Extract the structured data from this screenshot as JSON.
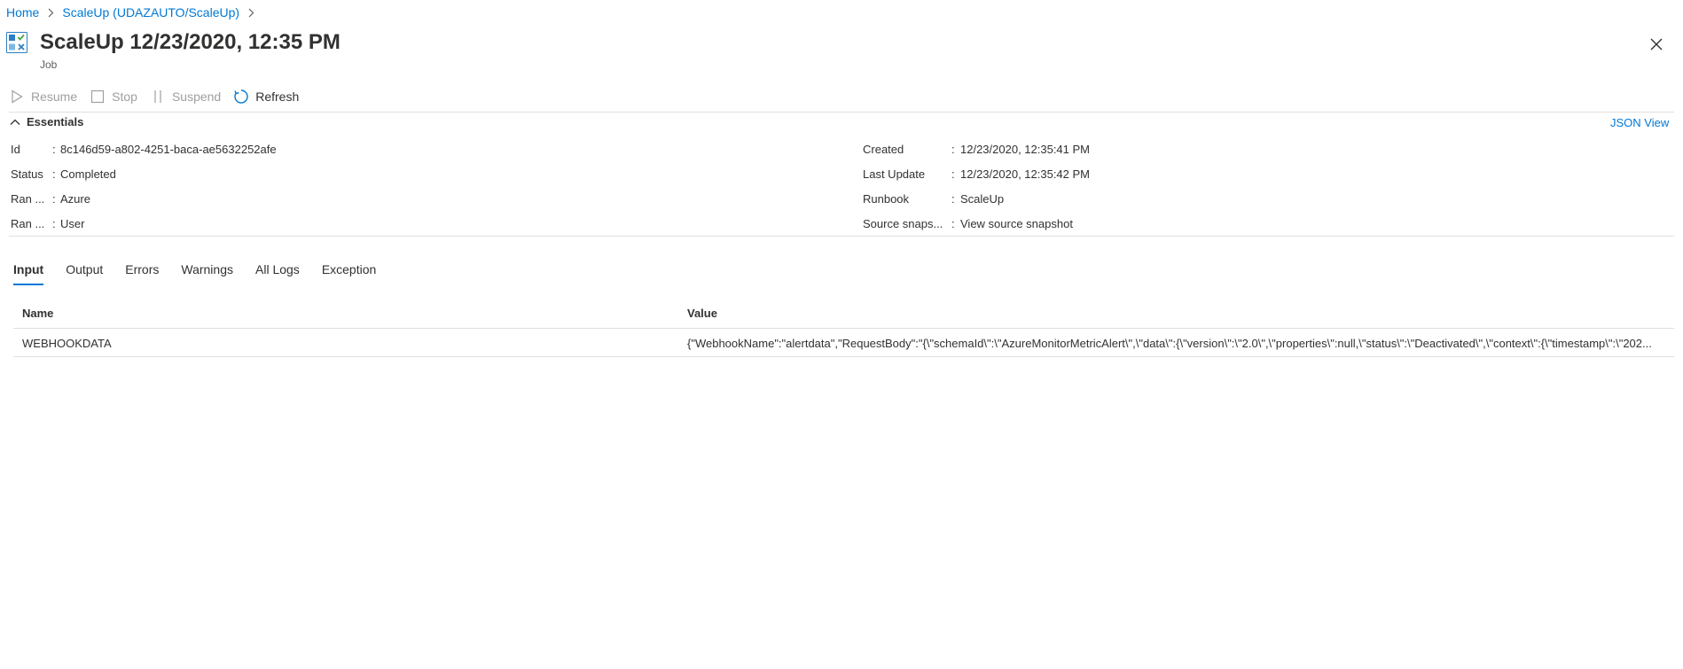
{
  "breadcrumb": {
    "items": [
      "Home",
      "ScaleUp (UDAZAUTO/ScaleUp)"
    ]
  },
  "header": {
    "title": "ScaleUp 12/23/2020, 12:35 PM",
    "subtitle": "Job",
    "icon": "automation-job-icon"
  },
  "toolbar": {
    "resume_label": "Resume",
    "stop_label": "Stop",
    "suspend_label": "Suspend",
    "refresh_label": "Refresh"
  },
  "essentials": {
    "label": "Essentials",
    "json_view": "JSON View",
    "left": [
      {
        "label": "Id",
        "value": "8c146d59-a802-4251-baca-ae5632252afe"
      },
      {
        "label": "Status",
        "value": "Completed"
      },
      {
        "label": "Ran ...",
        "value": "Azure"
      },
      {
        "label": "Ran ...",
        "value": "User"
      }
    ],
    "right": [
      {
        "label": "Created",
        "value": "12/23/2020, 12:35:41 PM"
      },
      {
        "label": "Last Update",
        "value": "12/23/2020, 12:35:42 PM"
      },
      {
        "label": "Runbook",
        "value": "ScaleUp"
      },
      {
        "label": "Source snaps...",
        "value": "View source snapshot"
      }
    ]
  },
  "tabs": [
    "Input",
    "Output",
    "Errors",
    "Warnings",
    "All Logs",
    "Exception"
  ],
  "active_tab": "Input",
  "table": {
    "headers": [
      "Name",
      "Value"
    ],
    "rows": [
      {
        "name": "WEBHOOKDATA",
        "value": "{\"WebhookName\":\"alertdata\",\"RequestBody\":\"{\\\"schemaId\\\":\\\"AzureMonitorMetricAlert\\\",\\\"data\\\":{\\\"version\\\":\\\"2.0\\\",\\\"properties\\\":null,\\\"status\\\":\\\"Deactivated\\\",\\\"context\\\":{\\\"timestamp\\\":\\\"202..."
      }
    ]
  },
  "colors": {
    "accent": "#0078d4",
    "text": "#323130",
    "disabled": "#a19f9d",
    "divider": "#e1dfdd"
  }
}
